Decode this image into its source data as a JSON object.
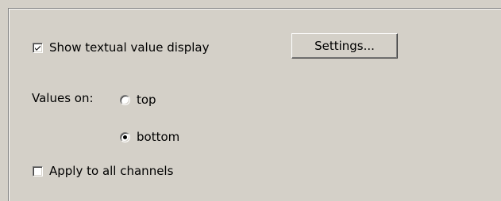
{
  "options": {
    "show_textual": {
      "label": "Show textual value display",
      "checked": true
    },
    "settings_button": {
      "label": "Settings..."
    },
    "values_on": {
      "label": "Values on:",
      "options": [
        {
          "label": "top",
          "selected": false
        },
        {
          "label": "bottom",
          "selected": true
        }
      ]
    },
    "apply_all": {
      "label": "Apply to all channels",
      "checked": false
    }
  }
}
